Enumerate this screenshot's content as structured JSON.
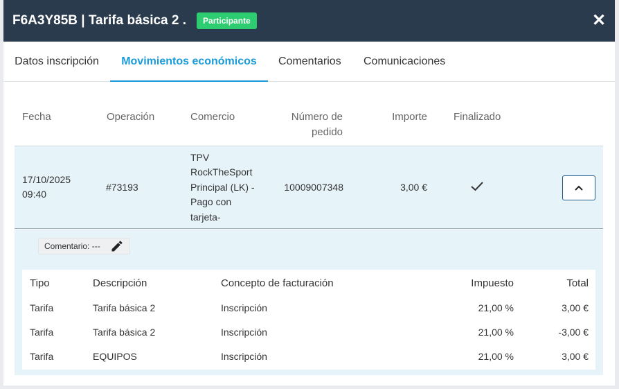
{
  "header": {
    "title": "F6A3Y85B | Tarifa básica 2 .",
    "badge": "Participante",
    "close_glyph": "✕",
    "colors": {
      "header_bg": "#2b3b4e",
      "badge_bg": "#2ecc71",
      "accent": "#1a9bd7"
    }
  },
  "tabs": [
    {
      "label": "Datos inscripción",
      "active": false
    },
    {
      "label": "Movimientos económicos",
      "active": true
    },
    {
      "label": "Comentarios",
      "active": false
    },
    {
      "label": "Comunicaciones",
      "active": false
    }
  ],
  "movements": {
    "columns": [
      "Fecha",
      "Operación",
      "Comercio",
      "Número de pedido",
      "Importe",
      "Finalizado"
    ],
    "column_display": {
      "fecha": "Fecha",
      "operacion": "Operación",
      "comercio": "Comercio",
      "pedido_line1": "Número de",
      "pedido_line2": "pedido",
      "importe": "Importe",
      "finalizado": "Finalizado"
    },
    "rows": [
      {
        "fecha_line1": "17/10/2025",
        "fecha_line2": "09:40",
        "operacion": "#73193",
        "comercio_lines": [
          "TPV",
          "RockTheSport",
          "Principal (LK) -",
          "Pago con",
          "tarjeta-"
        ],
        "pedido": "10009007348",
        "importe": "3,00 €",
        "finalizado": true,
        "expanded": true,
        "detail": {
          "comment_label": "Comentario: ---",
          "columns": {
            "tipo": "Tipo",
            "descripcion": "Descripción",
            "concepto": "Concepto de facturación",
            "impuesto": "Impuesto",
            "total": "Total"
          },
          "lines": [
            {
              "tipo": "Tarifa",
              "descripcion": "Tarifa básica 2",
              "concepto": "Inscripción",
              "impuesto": "21,00 %",
              "total": "3,00 €"
            },
            {
              "tipo": "Tarifa",
              "descripcion": "Tarifa básica 2",
              "concepto": "Inscripción",
              "impuesto": "21,00 %",
              "total": "-3,00 €"
            },
            {
              "tipo": "Tarifa",
              "descripcion": "EQUIPOS",
              "concepto": "Inscripción",
              "impuesto": "21,00 %",
              "total": "3,00 €"
            }
          ]
        }
      }
    ]
  },
  "icons": {
    "close": "close-icon",
    "check": "check-icon",
    "chevron": "chevron-up-icon",
    "edit": "pencil-icon"
  }
}
